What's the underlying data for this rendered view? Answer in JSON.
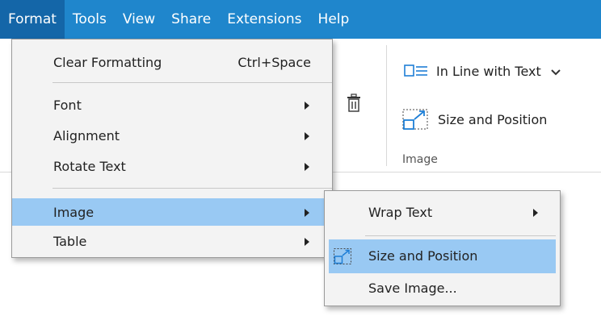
{
  "menubar": {
    "items": [
      {
        "label": "Format",
        "active": true
      },
      {
        "label": "Tools"
      },
      {
        "label": "View"
      },
      {
        "label": "Share"
      },
      {
        "label": "Extensions"
      },
      {
        "label": "Help"
      }
    ]
  },
  "ribbon": {
    "wrap_label": "In Line with Text",
    "size_label": "Size and Position",
    "group_label": "Image"
  },
  "format_menu": {
    "clear_formatting": {
      "label": "Clear Formatting",
      "shortcut": "Ctrl+Space"
    },
    "font": {
      "label": "Font"
    },
    "alignment": {
      "label": "Alignment"
    },
    "rotate_text": {
      "label": "Rotate Text"
    },
    "image": {
      "label": "Image",
      "highlighted": true
    },
    "table": {
      "label": "Table"
    }
  },
  "image_submenu": {
    "wrap_text": {
      "label": "Wrap Text"
    },
    "size_and_position": {
      "label": "Size and Position",
      "highlighted": true
    },
    "save_image": {
      "label": "Save Image..."
    }
  },
  "colors": {
    "menubar_bg": "#1f86cc",
    "menubar_active": "#1466a8",
    "highlight": "#99c9f3",
    "menu_bg": "#f3f3f3",
    "icon_accent": "#1f7fd6"
  }
}
